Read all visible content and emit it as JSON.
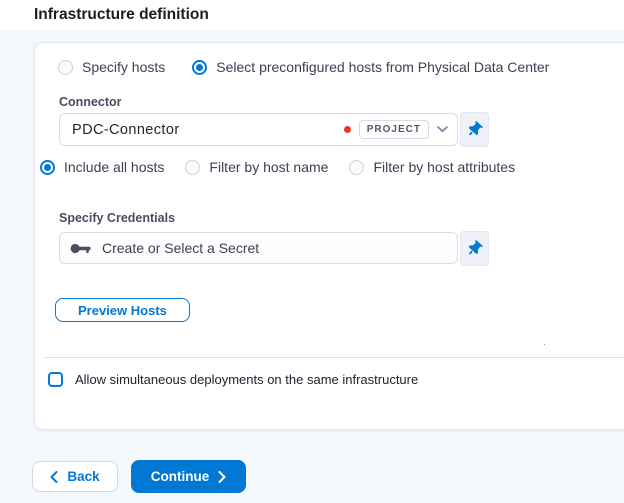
{
  "page": {
    "title": "Infrastructure definition"
  },
  "host_source": {
    "options": [
      {
        "label": "Specify hosts",
        "selected": false
      },
      {
        "label": "Select preconfigured hosts from Physical Data Center",
        "selected": true
      }
    ]
  },
  "connector": {
    "label": "Connector",
    "value": "PDC-Connector",
    "scope_badge": "PROJECT"
  },
  "host_filter": {
    "options": [
      {
        "label": "Include all hosts",
        "selected": true
      },
      {
        "label": "Filter by host name",
        "selected": false
      },
      {
        "label": "Filter by host attributes",
        "selected": false
      }
    ]
  },
  "credentials": {
    "label": "Specify Credentials",
    "placeholder": "Create or Select a Secret"
  },
  "preview_button": {
    "label": "Preview Hosts"
  },
  "simultaneous_checkbox": {
    "label": "Allow simultaneous deployments on the same infrastructure",
    "checked": false
  },
  "footer": {
    "back_label": "Back",
    "continue_label": "Continue"
  },
  "stray_mark": ".",
  "colors": {
    "accent": "#0278d5",
    "status_dot": "#e1382d",
    "page_bg": "#f3f8fc"
  }
}
